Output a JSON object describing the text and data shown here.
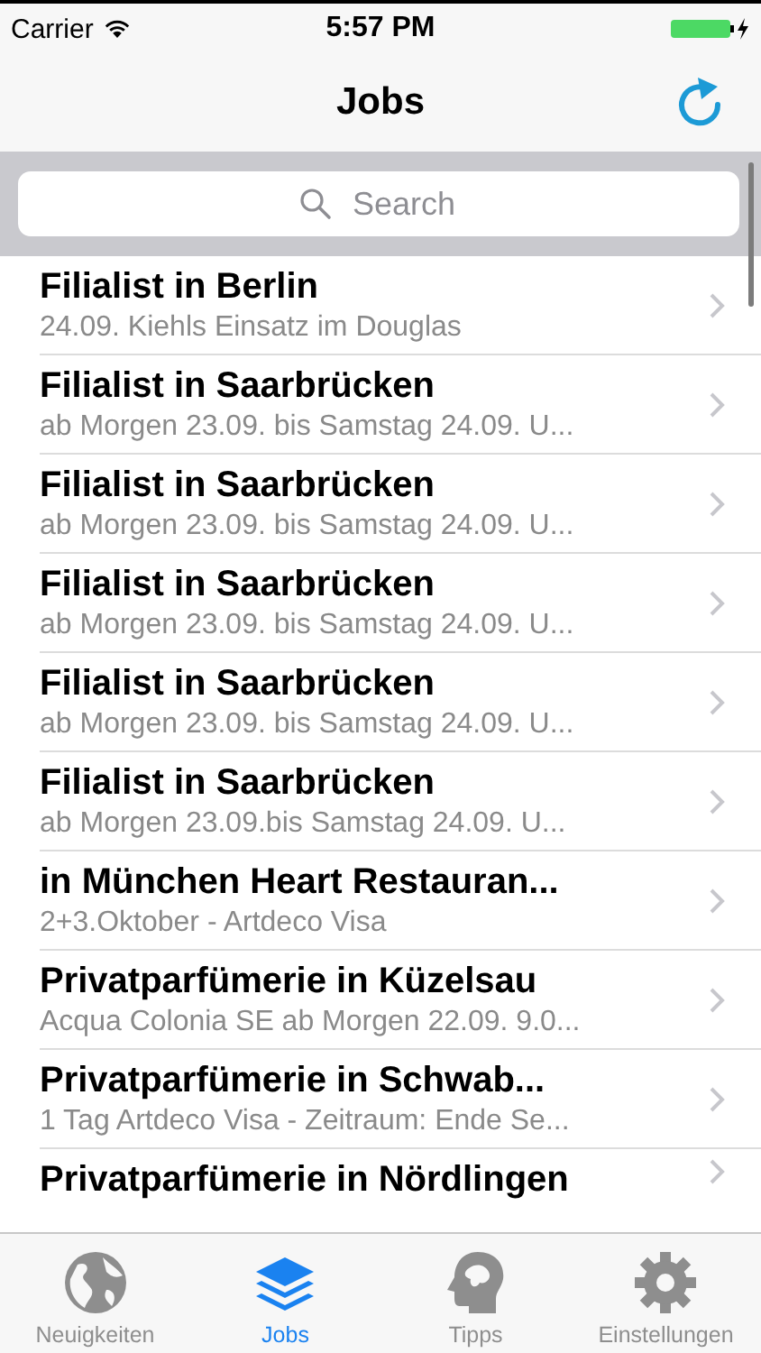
{
  "status_bar": {
    "carrier": "Carrier",
    "time": "5:57 PM"
  },
  "nav_bar": {
    "title": "Jobs"
  },
  "search": {
    "placeholder": "Search"
  },
  "rows": [
    {
      "title": "Filialist in Berlin",
      "subtitle": "24.09. Kiehls Einsatz im Douglas"
    },
    {
      "title": "Filialist in Saarbrücken",
      "subtitle": "ab Morgen 23.09. bis Samstag 24.09. U..."
    },
    {
      "title": "Filialist in Saarbrücken",
      "subtitle": "ab Morgen 23.09. bis Samstag 24.09. U..."
    },
    {
      "title": "Filialist in Saarbrücken",
      "subtitle": "ab Morgen 23.09. bis Samstag 24.09. U..."
    },
    {
      "title": "Filialist in Saarbrücken",
      "subtitle": "ab Morgen 23.09. bis Samstag 24.09. U..."
    },
    {
      "title": "Filialist in Saarbrücken",
      "subtitle": "ab Morgen 23.09.bis Samstag 24.09. U..."
    },
    {
      "title": " in München Heart Restauran...",
      "subtitle": "2+3.Oktober - Artdeco Visa"
    },
    {
      "title": "Privatparfümerie in Küzelsau",
      "subtitle": "Acqua Colonia SE ab Morgen 22.09. 9.0..."
    },
    {
      "title": "Privatparfümerie in Schwab...",
      "subtitle": "1 Tag Artdeco Visa - Zeitraum: Ende Se..."
    },
    {
      "title": "Privatparfümerie in Nördlingen"
    }
  ],
  "tabs": [
    {
      "label": "Neuigkeiten",
      "selected": false
    },
    {
      "label": "Jobs",
      "selected": true
    },
    {
      "label": "Tipps",
      "selected": false
    },
    {
      "label": "Einstellungen",
      "selected": false
    }
  ]
}
